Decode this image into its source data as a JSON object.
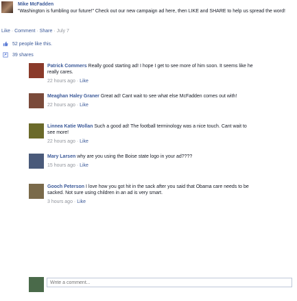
{
  "post": {
    "author": "Mike McFadden",
    "text": "\"Washington is fumbling our future!\" Check out our new campaign ad here, then LIKE and SHARE to help us spread the word!",
    "actions": {
      "like": "Like",
      "comment": "Comment",
      "share": "Share",
      "date": "July 7"
    },
    "likes_text": "52 people like this.",
    "shares_text": "39 shares"
  },
  "comments": [
    {
      "author": "Patrick Commers",
      "text": "Really good starting ad! I hope I get to see more of him soon. It seems like he really cares.",
      "time": "22 hours ago",
      "like": "Like",
      "avatar_color": "#8a3a2a"
    },
    {
      "author": "Meaghan Haley Graner",
      "text": "Great ad! Cant wait to see what else McFadden comes out with!",
      "time": "22 hours ago",
      "like": "Like",
      "avatar_color": "#7a4a3a"
    },
    {
      "author": "Linnea Katie Wollan",
      "text": "Such a good ad! The football terminology was a nice touch. Cant wait to see more!",
      "time": "22 hours ago",
      "like": "Like",
      "avatar_color": "#6b6a2a"
    },
    {
      "author": "Mary Larsen",
      "text": "why are you using the Boise state logo in your ad????",
      "time": "15 hours ago",
      "like": "Like",
      "avatar_color": "#4a5a7a"
    },
    {
      "author": "Gooch Peterson",
      "text": "I love how you got hit in the sack after you said that Obama care needs to be sacked. Not sure using children in an ad is very smart.",
      "time": "3 hours ago",
      "like": "Like",
      "avatar_color": "#7a6a4a"
    }
  ],
  "composer": {
    "placeholder": "Write a comment...",
    "avatar_color": "#4a6a4a"
  },
  "colors": {
    "link": "#3b5998",
    "meta": "#90949c"
  },
  "icons": {
    "like": "thumbs-up-icon",
    "share": "share-icon"
  }
}
